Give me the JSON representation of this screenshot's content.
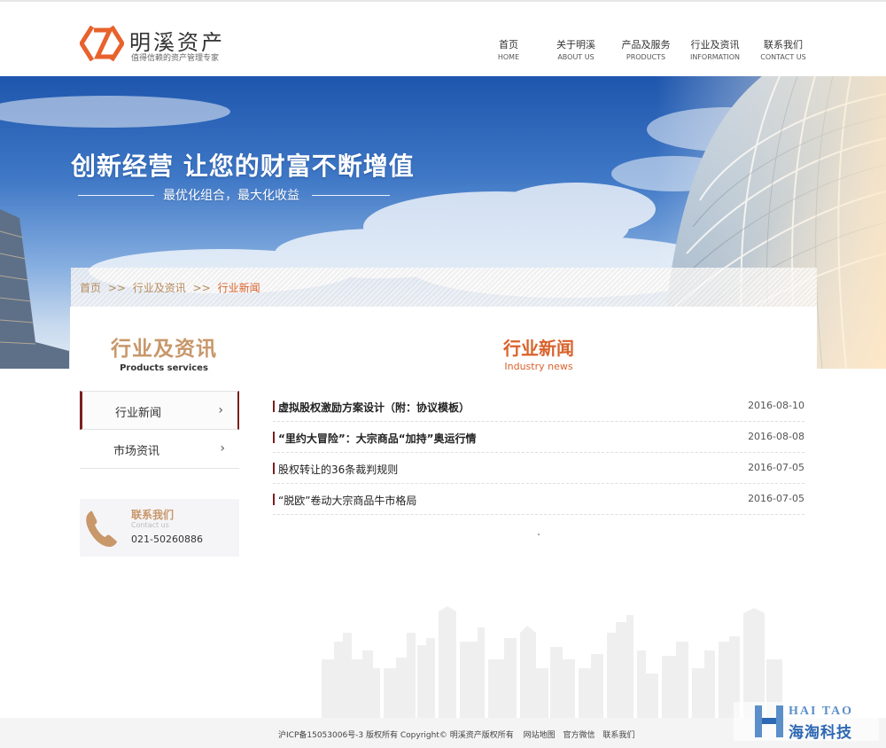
{
  "brand": {
    "name": "明溪资产",
    "slogan": "值得信赖的资产管理专家",
    "color_orange": "#e8622c",
    "color_gold": "#c8976a"
  },
  "nav": [
    {
      "zh": "首页",
      "en": "HOME"
    },
    {
      "zh": "关于明溪",
      "en": "ABOUT US"
    },
    {
      "zh": "产品及服务",
      "en": "PRODUCTS"
    },
    {
      "zh": "行业及资讯",
      "en": "INFORMATION"
    },
    {
      "zh": "联系我们",
      "en": "CONTACT US"
    }
  ],
  "banner": {
    "title": "创新经营  让您的财富不断增值",
    "subtitle": "最优化组合，最大化收益"
  },
  "breadcrumb": {
    "home": "首页",
    "separator": ">>",
    "section": "行业及资讯",
    "current": "行业新闻"
  },
  "sidebar": {
    "title": "行业及资讯",
    "title_en": "Products services",
    "items": [
      {
        "label": "行业新闻",
        "active": true
      },
      {
        "label": "市场资讯",
        "active": false
      }
    ],
    "chevron": "›"
  },
  "contact": {
    "title": "联系我们",
    "title_en": "Contact us",
    "phone": "021-50260886"
  },
  "main": {
    "title": "行业新闻",
    "title_en": "Industry news",
    "news": [
      {
        "title": "虚拟股权激励方案设计（附：协议模板）",
        "date": "2016-08-10",
        "bold": true
      },
      {
        "title": "“里约大冒险”：大宗商品“加持”奥运行情",
        "date": "2016-08-08",
        "bold": true
      },
      {
        "title": "股权转让的36条裁判规则",
        "date": "2016-07-05",
        "bold": false
      },
      {
        "title": "“脱欧”卷动大宗商品牛市格局",
        "date": "2016-07-05",
        "bold": false
      }
    ]
  },
  "footer": {
    "copyright": "沪ICP备15053006号-3 版权所有 Copyright© 明溪资产版权所有",
    "links": [
      "网站地图",
      "官方微信",
      "联系我们"
    ]
  },
  "watermark": {
    "en": "HAI TAO",
    "zh": "海淘科技"
  }
}
